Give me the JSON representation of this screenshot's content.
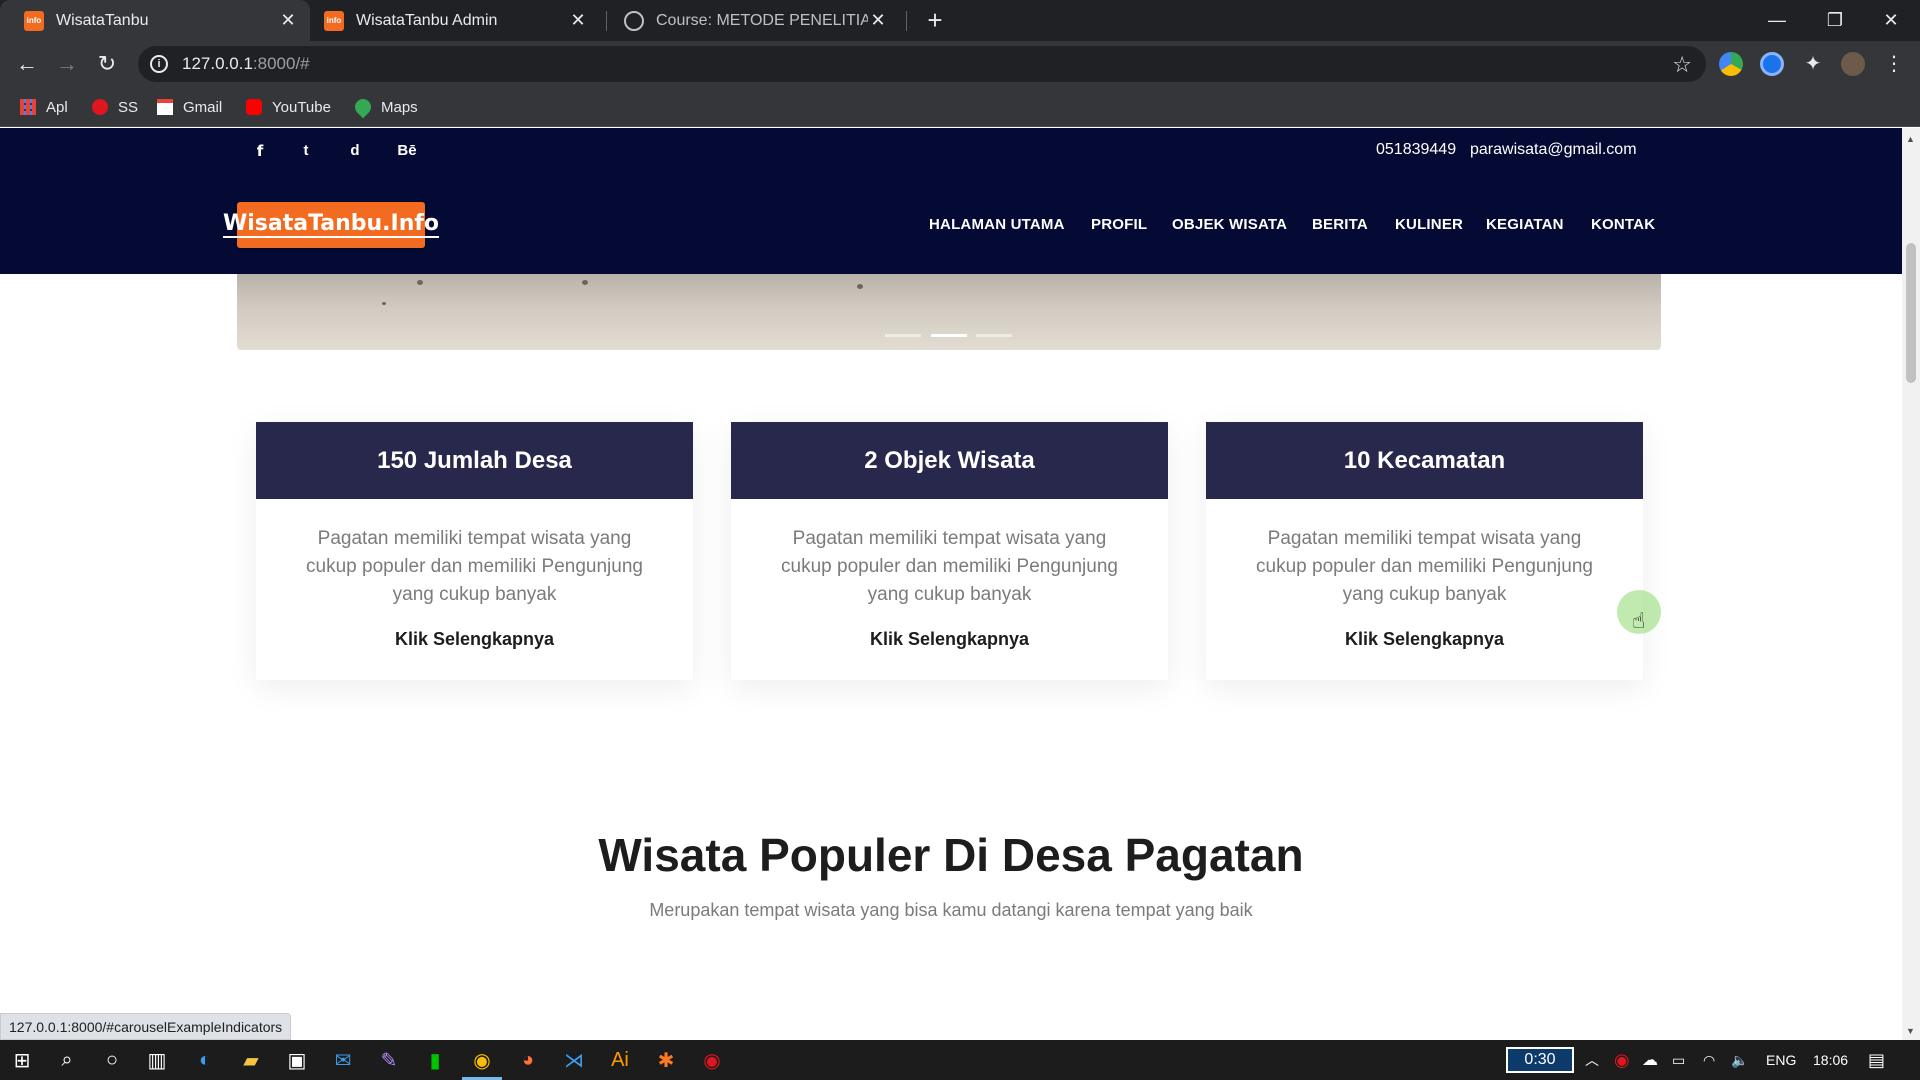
{
  "browser": {
    "tabs": [
      {
        "title": "WisataTanbu",
        "favicon": "info-favicon"
      },
      {
        "title": "WisataTanbu Admin",
        "favicon": "info-favicon"
      },
      {
        "title": "Course: METODE PENELITIAN DA",
        "favicon": "course-favicon"
      }
    ],
    "newtab_glyph": "+",
    "url_host": "127.0.0.1",
    "url_path": ":8000/#",
    "bookmarks": [
      {
        "label": "Apl",
        "icon": "apps-grid-icon"
      },
      {
        "label": "SS",
        "icon": "red-dot-icon"
      },
      {
        "label": "Gmail",
        "icon": "gmail-icon"
      },
      {
        "label": "YouTube",
        "icon": "youtube-icon"
      },
      {
        "label": "Maps",
        "icon": "maps-icon"
      }
    ],
    "status_url": "127.0.0.1:8000/#carouselExampleIndicators"
  },
  "site": {
    "social": [
      "f",
      "t",
      "d",
      "Bē"
    ],
    "phone": "051839449",
    "email": "parawisata@gmail.com",
    "logo_text": "WisataTanbu.Info",
    "nav": [
      "HALAMAN UTAMA",
      "PROFIL",
      "OBJEK WISATA",
      "BERITA",
      "KULINER",
      "KEGIATAN",
      "KONTAK"
    ],
    "carousel_active_index": 1,
    "cards": [
      {
        "title": "150 Jumlah Desa",
        "text": "Pagatan memiliki tempat wisata yang cukup populer dan memiliki Pengunjung yang cukup banyak",
        "link": "Klik Selengkapnya"
      },
      {
        "title": "2 Objek Wisata",
        "text": "Pagatan memiliki tempat wisata yang cukup populer dan memiliki Pengunjung yang cukup banyak",
        "link": "Klik Selengkapnya"
      },
      {
        "title": "10 Kecamatan",
        "text": "Pagatan memiliki tempat wisata yang cukup populer dan memiliki Pengunjung yang cukup banyak",
        "link": "Klik Selengkapnya"
      }
    ],
    "section_title": "Wisata Populer Di Desa Pagatan",
    "section_subtitle": "Merupakan tempat wisata yang bisa kamu datangi karena tempat yang baik"
  },
  "taskbar": {
    "timer": "0:30",
    "language": "ENG",
    "clock": "18:06"
  },
  "colors": {
    "header_bg": "#040a33",
    "logo_bg": "#f36b21",
    "card_head_bg": "#28284d"
  }
}
